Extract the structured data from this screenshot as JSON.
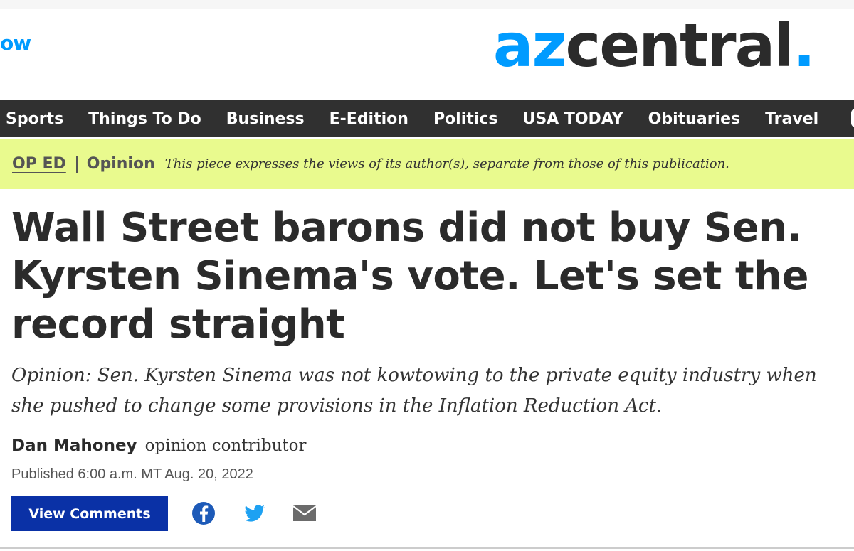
{
  "header": {
    "cut_link": "ow",
    "logo": {
      "part1": "az",
      "part2": "central",
      "part3": "."
    }
  },
  "nav": {
    "items": [
      {
        "label": "Sports"
      },
      {
        "label": "Things To Do"
      },
      {
        "label": "Business"
      },
      {
        "label": "E-Edition"
      },
      {
        "label": "Politics"
      },
      {
        "label": "USA TODAY"
      },
      {
        "label": "Obituaries"
      },
      {
        "label": "Travel"
      }
    ]
  },
  "label_bar": {
    "oped": "OP ED",
    "opinion": "Opinion",
    "disclaimer": "This piece expresses the views of its author(s), separate from those of this publication."
  },
  "article": {
    "headline": "Wall Street barons did not buy Sen. Kyrsten Sinema's vote. Let's set the record straight",
    "subhead": "Opinion: Sen. Kyrsten Sinema was not kowtowing to the private equity industry when she pushed to change some provisions in the Inflation Reduction Act.",
    "author": "Dan Mahoney",
    "author_role": "opinion contributor",
    "published": "Published 6:00 a.m. MT Aug. 20, 2022"
  },
  "actions": {
    "comments_label": "View Comments",
    "share_icons": [
      "facebook-icon",
      "twitter-icon",
      "email-icon"
    ]
  },
  "colors": {
    "brand_blue": "#009bff",
    "nav_bg": "#303030",
    "oped_bg": "#e9fa8e",
    "button_blue": "#0a31a6",
    "icon_blue": "#1d5ab8",
    "twitter_blue": "#1da1f2",
    "icon_gray": "#6b6b6b"
  }
}
